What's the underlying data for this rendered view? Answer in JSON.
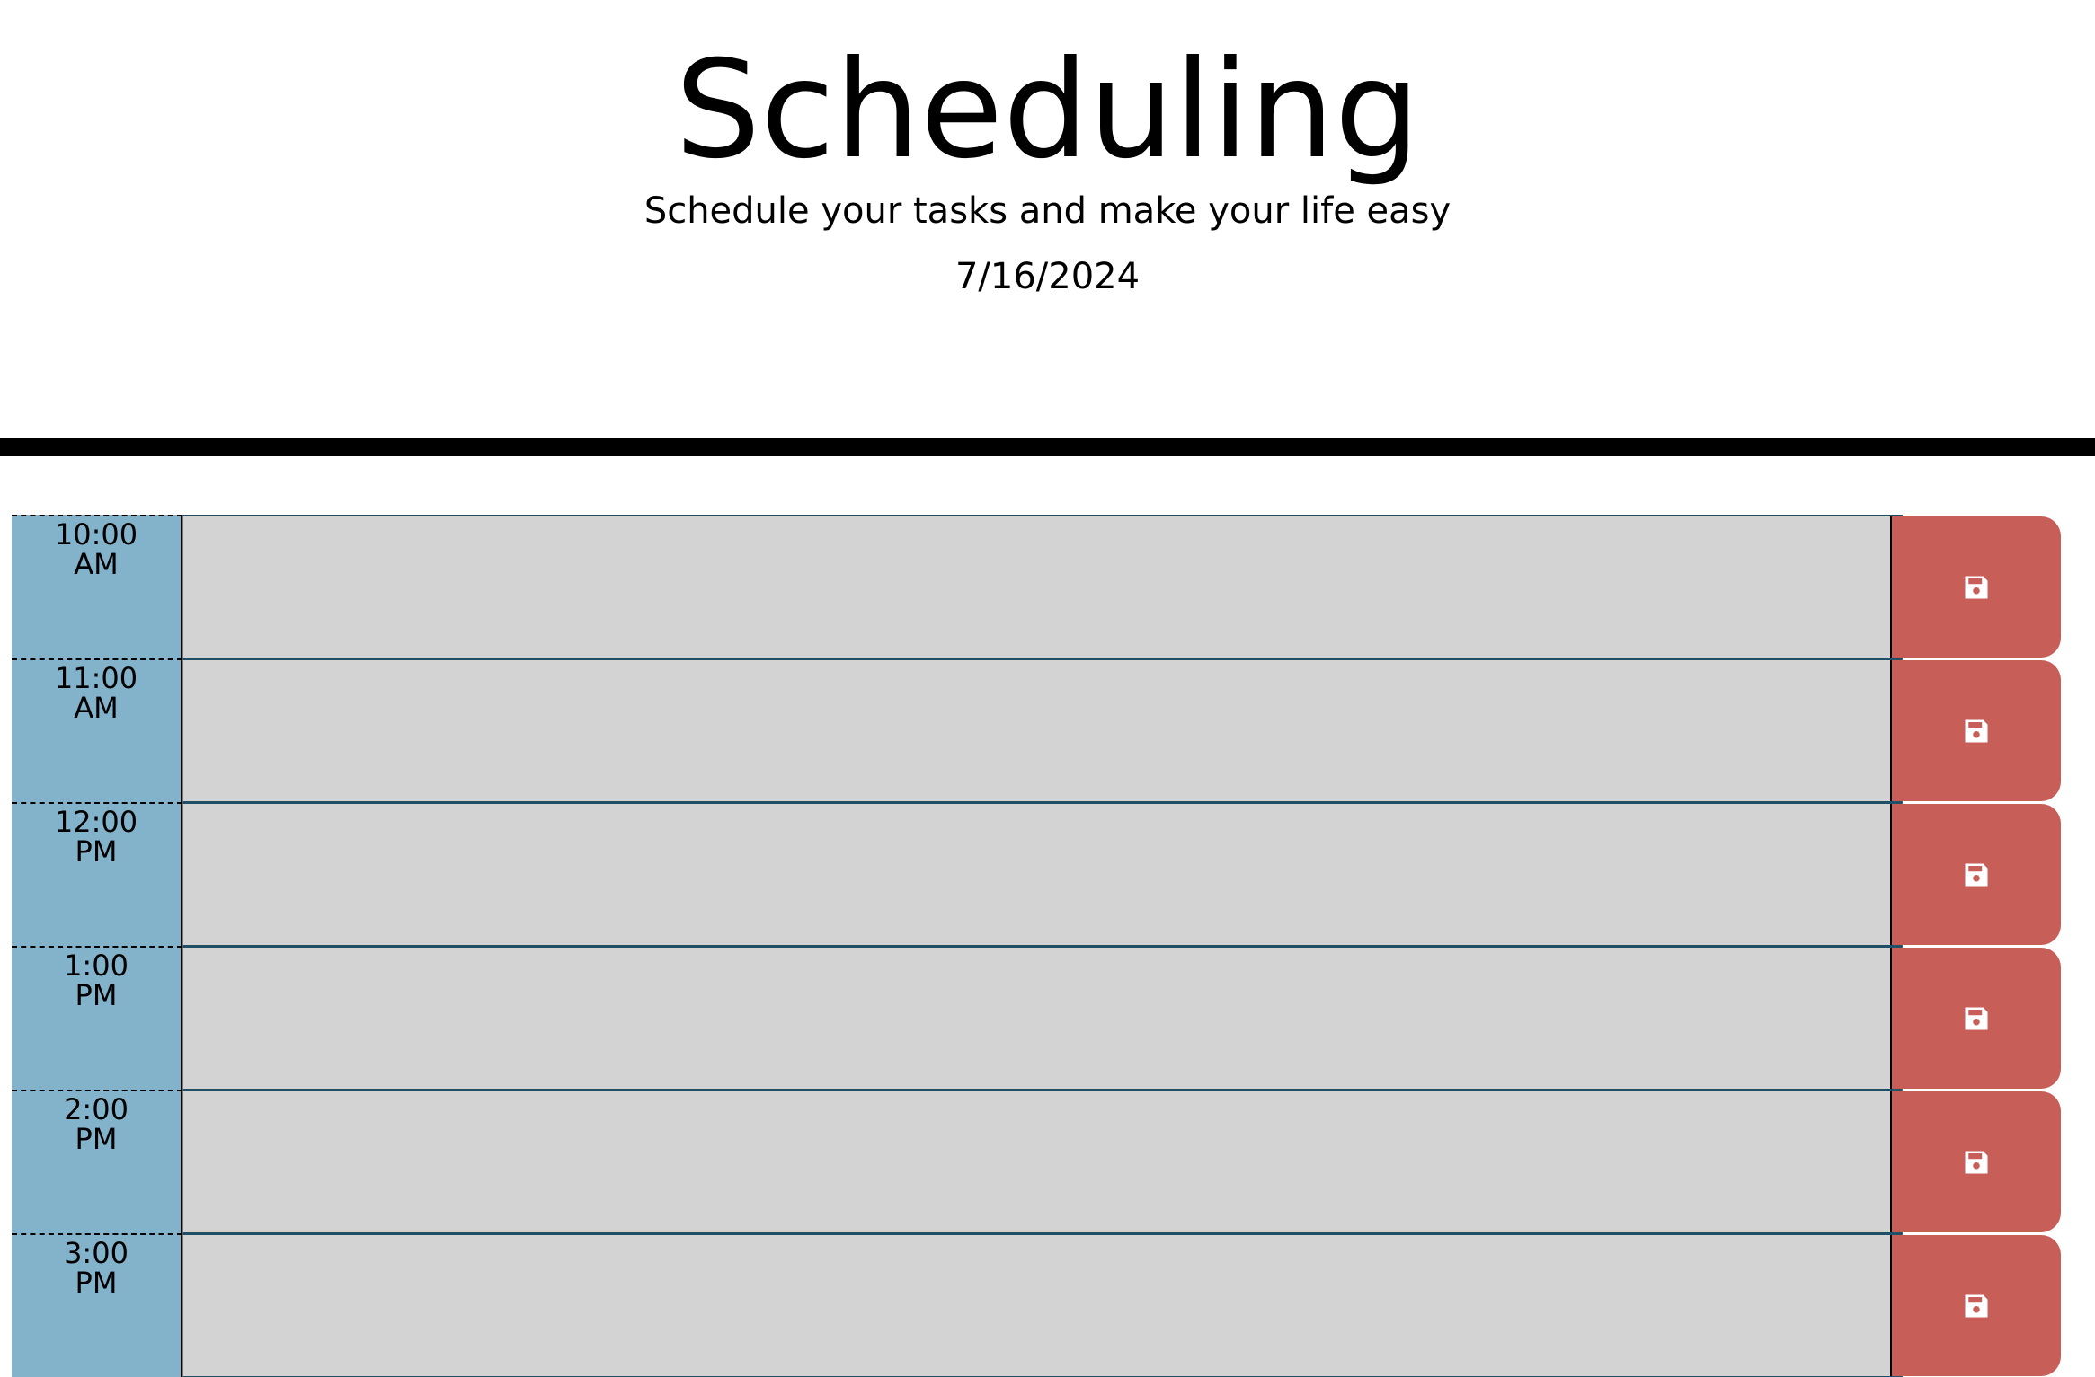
{
  "header": {
    "title": "Scheduling",
    "subtitle": "Schedule your tasks and make your life easy",
    "date": "7/16/2024"
  },
  "rows": [
    {
      "time": "10:00 AM",
      "task": ""
    },
    {
      "time": "11:00 AM",
      "task": ""
    },
    {
      "time": "12:00 PM",
      "task": ""
    },
    {
      "time": "1:00 PM",
      "task": ""
    },
    {
      "time": "2:00 PM",
      "task": ""
    },
    {
      "time": "3:00 PM",
      "task": ""
    }
  ],
  "save_icon": "floppy-disk-icon",
  "colors": {
    "hour_bg": "#83b2cb",
    "task_bg": "#d3d3d3",
    "save_bg": "#c75e58"
  }
}
